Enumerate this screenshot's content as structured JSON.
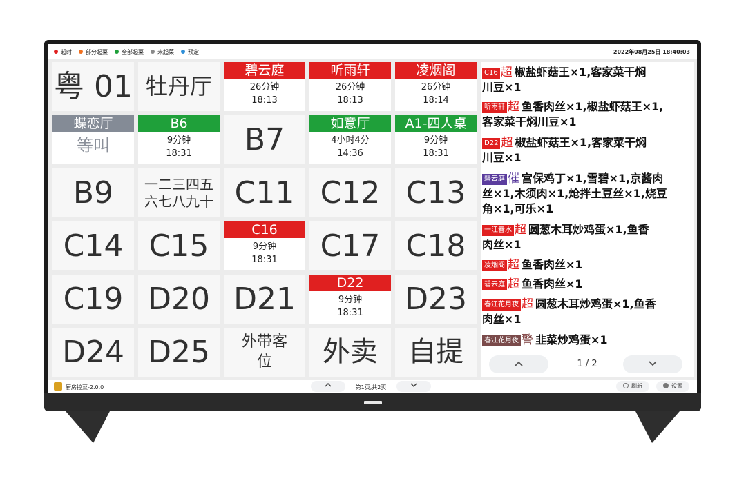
{
  "legend": [
    {
      "label": "超时",
      "color": "#e02020"
    },
    {
      "label": "部分起菜",
      "color": "#f07020"
    },
    {
      "label": "全部起菜",
      "color": "#1fa03a"
    },
    {
      "label": "未起菜",
      "color": "#8a8a8a"
    },
    {
      "label": "预定",
      "color": "#2f8fd8"
    }
  ],
  "datetime": "2022年08月25日 18:40:03",
  "tables": {
    "t1": {
      "name": "粤 01"
    },
    "t2": {
      "name": "牡丹厅"
    },
    "t3": {
      "name": "碧云庭",
      "duration": "26分钟",
      "time": "18:13"
    },
    "t4": {
      "name": "听雨轩",
      "duration": "26分钟",
      "time": "18:13"
    },
    "t5": {
      "name": "凌烟阁",
      "duration": "26分钟",
      "time": "18:14"
    },
    "t6": {
      "name": "蝶恋厅",
      "status": "等叫"
    },
    "t7": {
      "name": "B6",
      "duration": "9分钟",
      "time": "18:31"
    },
    "t8": {
      "name": "B7"
    },
    "t9": {
      "name": "如意厅",
      "duration": "4小时4分",
      "time": "14:36"
    },
    "t10": {
      "name": "A1-四人桌",
      "duration": "9分钟",
      "time": "18:31"
    },
    "t11": {
      "name": "B9"
    },
    "t12": {
      "name_line1": "一二三四五",
      "name_line2": "六七八九十"
    },
    "t13": {
      "name": "C11"
    },
    "t14": {
      "name": "C12"
    },
    "t15": {
      "name": "C13"
    },
    "t16": {
      "name": "C14"
    },
    "t17": {
      "name": "C15"
    },
    "t18": {
      "name": "C16",
      "duration": "9分钟",
      "time": "18:31"
    },
    "t19": {
      "name": "C17"
    },
    "t20": {
      "name": "C18"
    },
    "t21": {
      "name": "C19"
    },
    "t22": {
      "name": "D20"
    },
    "t23": {
      "name": "D21"
    },
    "t24": {
      "name": "D22",
      "duration": "9分钟",
      "time": "18:31"
    },
    "t25": {
      "name": "D23"
    },
    "t26": {
      "name": "D24"
    },
    "t27": {
      "name": "D25"
    },
    "t28": {
      "name_line1": "外带客",
      "name_line2": "位"
    },
    "t29": {
      "name": "外卖"
    },
    "t30": {
      "name": "自提"
    }
  },
  "orders": [
    {
      "table": "C16",
      "mark": "超",
      "line1": "椒盐虾菇王×1,客家菜干焖",
      "line2": "川豆×1"
    },
    {
      "table": "听雨轩",
      "mark": "超",
      "line1": "鱼香肉丝×1,椒盐虾菇王×1,",
      "line2": "客家菜干焖川豆×1"
    },
    {
      "table": "D22",
      "mark": "超",
      "line1": "椒盐虾菇王×1,客家菜干焖",
      "line2": "川豆×1"
    },
    {
      "table": "碧云庭",
      "mark": "催",
      "line1": "宫保鸡丁×1,雪碧×1,京酱肉",
      "line2": "丝×1,木须肉×1,炝拌土豆丝×1,烧豆",
      "line3": "角×1,可乐×1"
    },
    {
      "table": "一江春水",
      "mark": "超",
      "line1": "圆葱木耳炒鸡蛋×1,鱼香",
      "line2": "肉丝×1"
    },
    {
      "table": "凌烟阁",
      "mark": "超",
      "line1": "鱼香肉丝×1"
    },
    {
      "table": "碧云庭",
      "mark": "超",
      "line1": "鱼香肉丝×1"
    },
    {
      "table": "春江花月夜",
      "mark": "超",
      "line1": "圆葱木耳炒鸡蛋×1,鱼香",
      "line2": "肉丝×1"
    },
    {
      "table": "春江花月夜",
      "mark": "警",
      "line1": "韭菜炒鸡蛋×1"
    }
  ],
  "order_pager": {
    "up_icon": "chevron-up-icon",
    "down_icon": "chevron-down-icon",
    "page": "1 / 2"
  },
  "footer": {
    "app_name": "厨房控菜-2.0.0",
    "page_text": "第1页,共2页",
    "refresh_label": "刷新",
    "settings_label": "设置"
  }
}
